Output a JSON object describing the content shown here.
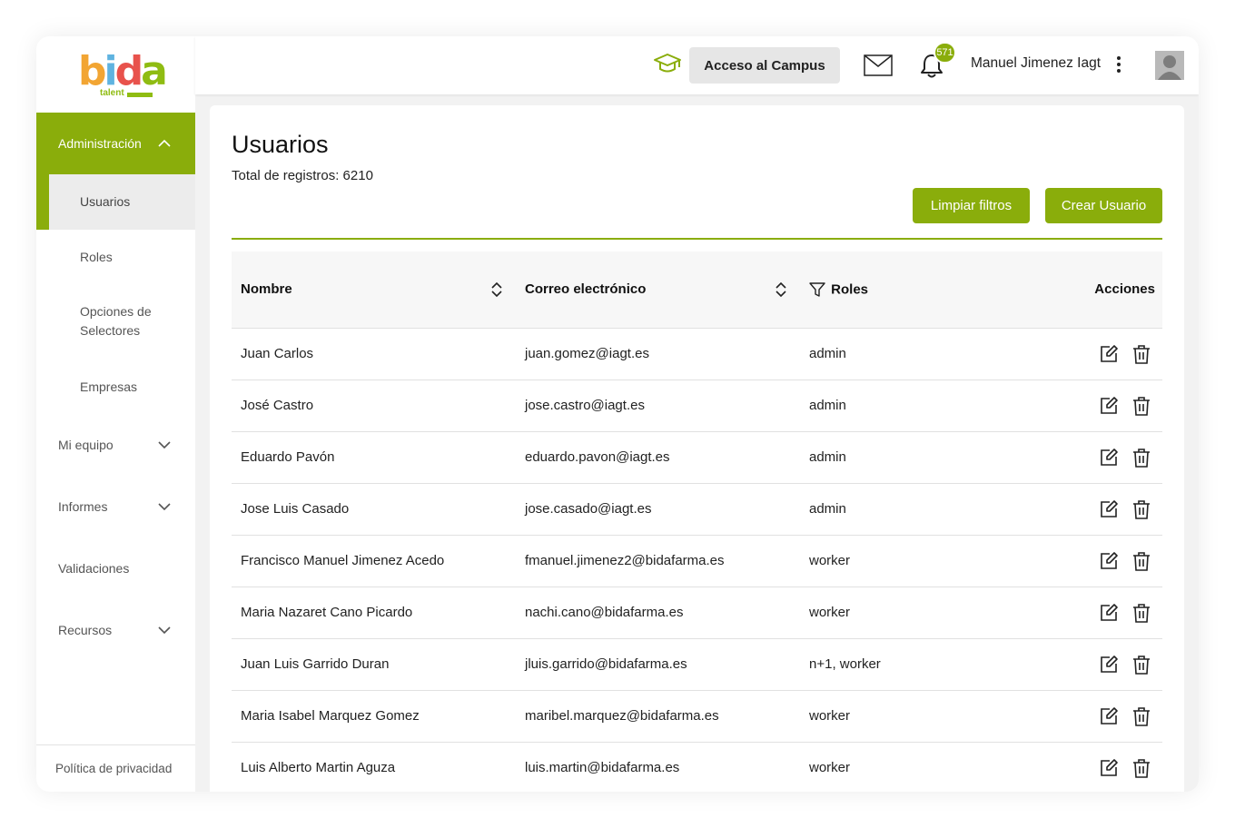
{
  "brand": {
    "logo_letters": [
      "b",
      "i",
      "d",
      "a"
    ],
    "logo_sub": "talent",
    "colors": {
      "accent": "#8aad0b",
      "logo_b": "#f2a533",
      "logo_i": "#5fb3e0",
      "logo_d": "#e8524c",
      "logo_a": "#8fbc12"
    }
  },
  "sidebar": {
    "admin": {
      "label": "Administración",
      "icon": "chevron-up-icon"
    },
    "admin_items": [
      {
        "label": "Usuarios",
        "active": true
      },
      {
        "label": "Roles",
        "active": false
      },
      {
        "label_lines": [
          "Opciones de",
          "Selectores"
        ],
        "active": false
      },
      {
        "label": "Empresas",
        "active": false
      }
    ],
    "items": [
      {
        "label": "Mi equipo",
        "icon": "chevron-down-icon"
      },
      {
        "label": "Informes",
        "icon": "chevron-down-icon"
      },
      {
        "label": "Validaciones",
        "icon": ""
      },
      {
        "label": "Recursos",
        "icon": "chevron-down-icon"
      }
    ],
    "privacy": "Política de privacidad"
  },
  "header": {
    "campus_label": "Acceso al Campus",
    "notifications_count": "571",
    "user_name": "Manuel Jimenez Iagt"
  },
  "main": {
    "title": "Usuarios",
    "total": "Total de registros: 6210",
    "clear_filters": "Limpiar filtros",
    "create_user": "Crear Usuario",
    "columns": [
      "Nombre",
      "Correo electrónico",
      "Roles",
      "Acciones"
    ],
    "rows": [
      {
        "name": "Juan Carlos",
        "email": "juan.gomez@iagt.es",
        "roles": "admin"
      },
      {
        "name": "José Castro",
        "email": "jose.castro@iagt.es",
        "roles": "admin"
      },
      {
        "name": "Eduardo Pavón",
        "email": "eduardo.pavon@iagt.es",
        "roles": "admin"
      },
      {
        "name": "Jose Luis Casado",
        "email": "jose.casado@iagt.es",
        "roles": "admin"
      },
      {
        "name": "Francisco Manuel Jimenez Acedo",
        "email": "fmanuel.jimenez2@bidafarma.es",
        "roles": "worker"
      },
      {
        "name": "Maria Nazaret Cano Picardo",
        "email": "nachi.cano@bidafarma.es",
        "roles": "worker"
      },
      {
        "name": "Juan Luis Garrido Duran",
        "email": "jluis.garrido@bidafarma.es",
        "roles": "n+1, worker"
      },
      {
        "name": "Maria Isabel Marquez Gomez",
        "email": "maribel.marquez@bidafarma.es",
        "roles": "worker"
      },
      {
        "name": "Luis Alberto Martin Aguza",
        "email": "luis.martin@bidafarma.es",
        "roles": "worker"
      }
    ]
  }
}
